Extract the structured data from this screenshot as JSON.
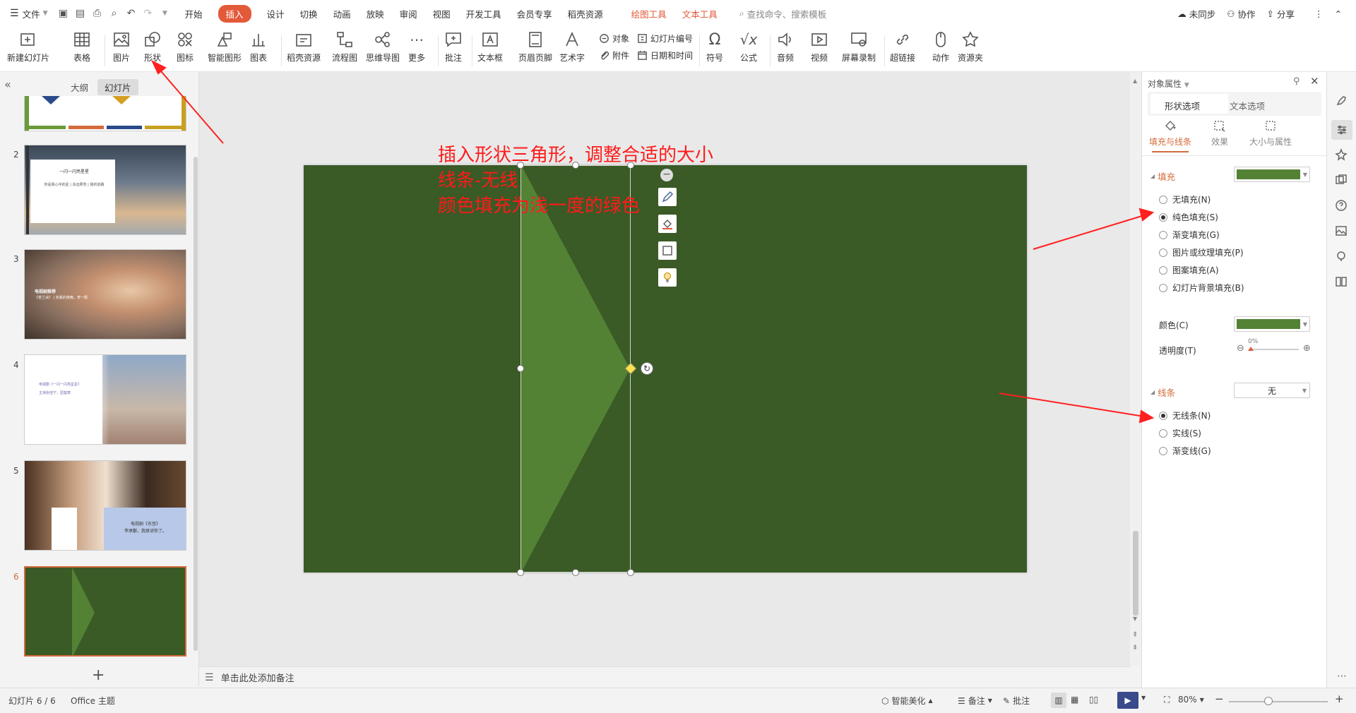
{
  "menu": {
    "file": "文件",
    "tabs": [
      "开始",
      "插入",
      "设计",
      "切换",
      "动画",
      "放映",
      "审阅",
      "视图",
      "开发工具",
      "会员专享",
      "稻壳资源"
    ],
    "context_tabs": [
      "绘图工具",
      "文本工具"
    ],
    "search": "查找命令、搜索模板",
    "sync": "未同步",
    "collab": "协作",
    "share": "分享"
  },
  "ribbon": {
    "new_slide": "新建幻灯片",
    "table": "表格",
    "picture": "图片",
    "shape": "形状",
    "icon": "图标",
    "smart_art": "智能图形",
    "chart": "图表",
    "docer": "稻壳资源",
    "flowchart": "流程图",
    "mindmap": "思维导图",
    "more": "更多",
    "comment": "批注",
    "textbox": "文本框",
    "header_footer": "页眉页脚",
    "wordart": "艺术字",
    "object": "对象",
    "attachment": "附件",
    "slide_number": "幻灯片编号",
    "datetime": "日期和时间",
    "symbol": "符号",
    "formula": "公式",
    "audio": "音频",
    "video": "视频",
    "screen_record": "屏幕录制",
    "hyperlink": "超链接",
    "action": "动作",
    "resource": "资源夹"
  },
  "left_panel": {
    "tab_outline": "大纲",
    "tab_slides": "幻灯片",
    "slides": [
      {
        "num": "2",
        "title": "一闪一闪亮星星",
        "text": "你是我心中的星 | 永远照亮 | 我的前路"
      },
      {
        "num": "3",
        "title": "电视剧推荐",
        "text": "《苍兰诀》 | 初夏的夜晚，李一桐"
      },
      {
        "num": "4",
        "title": "电视剧《一闪一闪亮星星》",
        "text": "主演张佳宁，屈楚萧"
      },
      {
        "num": "5",
        "title": "电视剧《东宫》",
        "text": "李承鄞，我原谅你了。"
      },
      {
        "num": "6",
        "title": "",
        "text": ""
      }
    ],
    "add_icon": "+"
  },
  "annotation": {
    "line1": "插入形状三角形，调整合适的大小",
    "line2": "线条-无线",
    "line3": "颜色填充为浅一度的绿色"
  },
  "notes_placeholder": "单击此处添加备注",
  "status": {
    "slide_count": "幻灯片 6 / 6",
    "theme": "Office 主题",
    "smart_beautify": "智能美化",
    "notes": "备注",
    "comments": "批注",
    "zoom": "80%"
  },
  "props": {
    "title": "对象属性",
    "tab_shape": "形状选项",
    "tab_text": "文本选项",
    "sub_fill_line": "填充与线条",
    "sub_effect": "效果",
    "sub_size": "大小与属性",
    "fill_section": "填充",
    "fill_options": [
      "无填充(N)",
      "纯色填充(S)",
      "渐变填充(G)",
      "图片或纹理填充(P)",
      "图案填充(A)",
      "幻灯片背景填充(B)"
    ],
    "fill_selected": 1,
    "color_label": "颜色(C)",
    "transparency_label": "透明度(T)",
    "transparency_value": "0%",
    "line_section": "线条",
    "line_value": "无",
    "line_options": [
      "无线条(N)",
      "实线(S)",
      "渐变线(G)"
    ],
    "line_selected": 0
  },
  "colors": {
    "slide_bg": "#3a5a26",
    "triangle": "#548235",
    "fill_swatch": "#548235",
    "accent": "#e35a3a",
    "annotation_text": "#ff1a1a",
    "arrow": "#ff2020"
  }
}
